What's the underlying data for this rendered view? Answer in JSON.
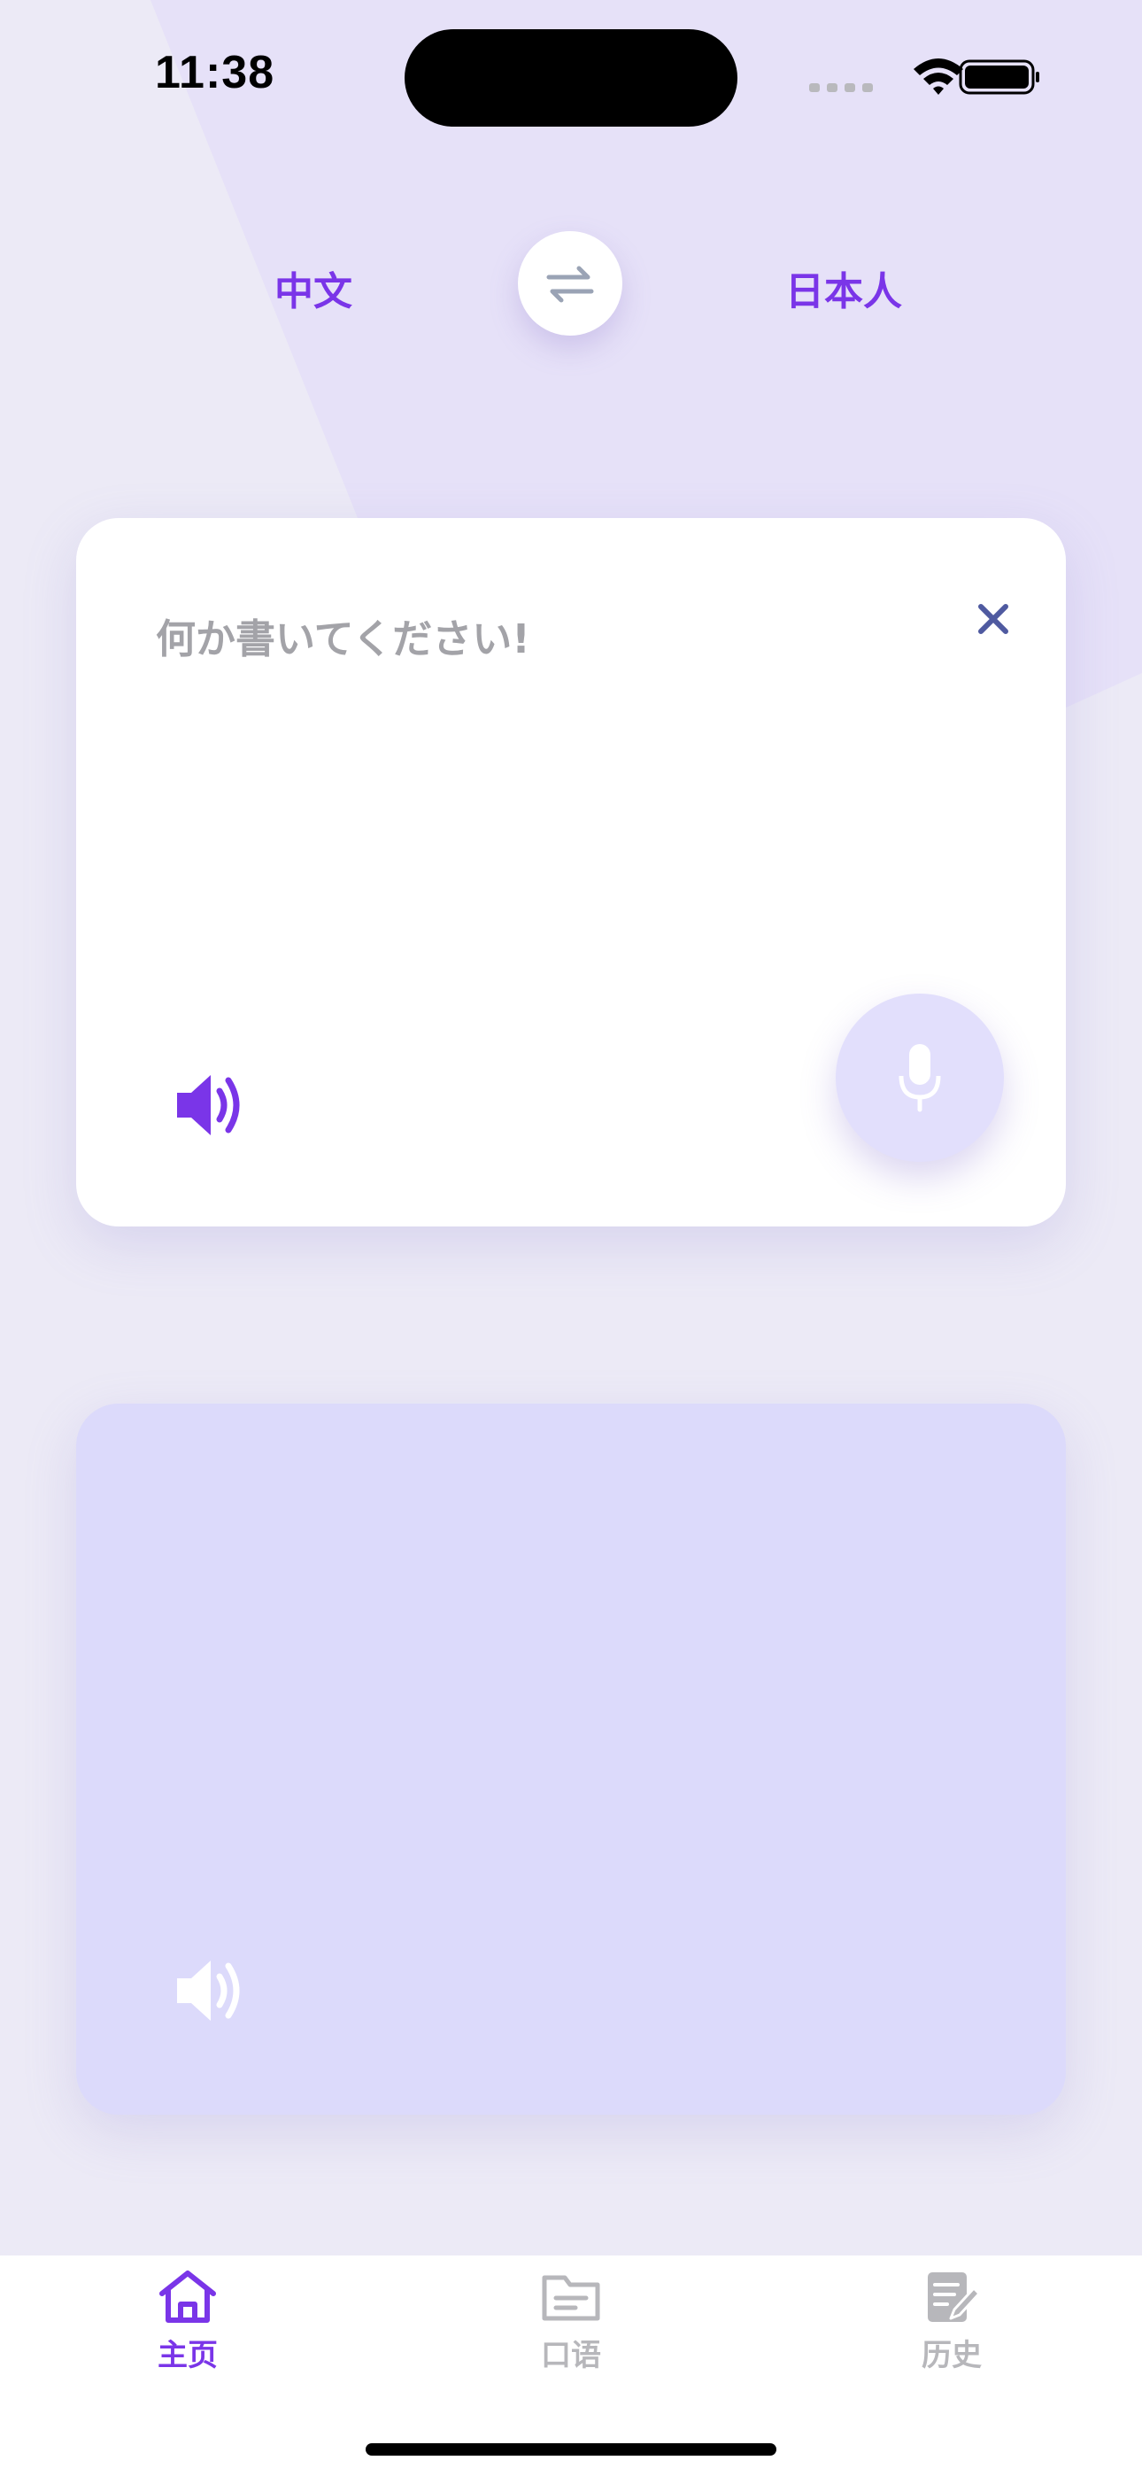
{
  "status_bar": {
    "time": "11:38"
  },
  "languages": {
    "source": "中文",
    "target": "日本人"
  },
  "input_card": {
    "placeholder": "何か書いてください!"
  },
  "tabs": [
    {
      "label": "主页",
      "icon": "home-icon",
      "active": true
    },
    {
      "label": "口语",
      "icon": "folder-icon",
      "active": false
    },
    {
      "label": "历史",
      "icon": "document-edit-icon",
      "active": false
    }
  ],
  "colors": {
    "accent": "#7a35e8",
    "background": "#eceaf6",
    "output_card": "#dcdafb",
    "inactive_tab": "#b7b7bb"
  }
}
